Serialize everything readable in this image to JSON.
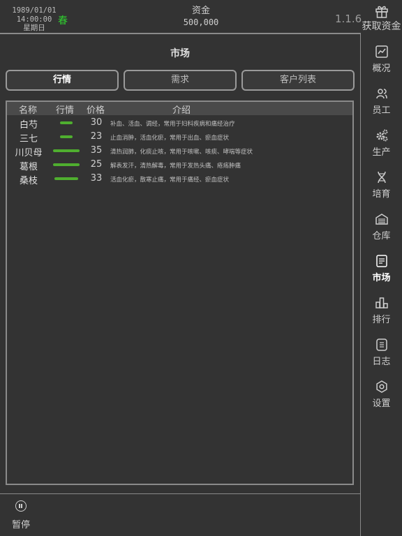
{
  "header": {
    "date": "1989/01/01",
    "time": "14:00:00",
    "weekday": "星期日",
    "season": "春",
    "funds_label": "资金",
    "funds_value": "500,000",
    "version": "1.1.6",
    "get_funds_label": "获取资金"
  },
  "page": {
    "title": "市场"
  },
  "tabs": [
    {
      "label": "行情",
      "active": true
    },
    {
      "label": "需求",
      "active": false
    },
    {
      "label": "客户列表",
      "active": false
    }
  ],
  "table": {
    "columns": [
      "名称",
      "行情",
      "价格",
      "介绍"
    ],
    "rows": [
      {
        "name": "白芍",
        "trend": 0.45,
        "price": "30",
        "desc": "补血、活血、调经，常用于妇科疾病和痛经治疗"
      },
      {
        "name": "三七",
        "trend": 0.45,
        "price": "23",
        "desc": "止血消肿，活血化瘀，常用于出血、瘀血症状"
      },
      {
        "name": "川贝母",
        "trend": 0.95,
        "price": "35",
        "desc": "清热润肺，化痰止咳，常用于咳嗽、咳痰、哮喘等症状"
      },
      {
        "name": "葛根",
        "trend": 0.95,
        "price": "25",
        "desc": "解表发汗，清热解毒，常用于发热头痛、疮疡肿痛"
      },
      {
        "name": "桑枝",
        "trend": 0.85,
        "price": "33",
        "desc": "活血化瘀，散寒止痛，常用于痛经、瘀血症状"
      }
    ]
  },
  "sidebar": {
    "items": [
      {
        "label": "概况",
        "icon": "chart-icon"
      },
      {
        "label": "员工",
        "icon": "people-icon"
      },
      {
        "label": "生产",
        "icon": "gears-icon"
      },
      {
        "label": "培育",
        "icon": "dna-icon"
      },
      {
        "label": "仓库",
        "icon": "warehouse-icon"
      },
      {
        "label": "市场",
        "icon": "market-icon",
        "active": true
      },
      {
        "label": "排行",
        "icon": "ranking-icon"
      },
      {
        "label": "日志",
        "icon": "log-icon"
      },
      {
        "label": "设置",
        "icon": "settings-icon"
      }
    ]
  },
  "footer": {
    "pause_label": "暂停"
  },
  "colors": {
    "background": "#333333",
    "accent_green": "#4fae2f",
    "season_green": "#2fd02f"
  }
}
